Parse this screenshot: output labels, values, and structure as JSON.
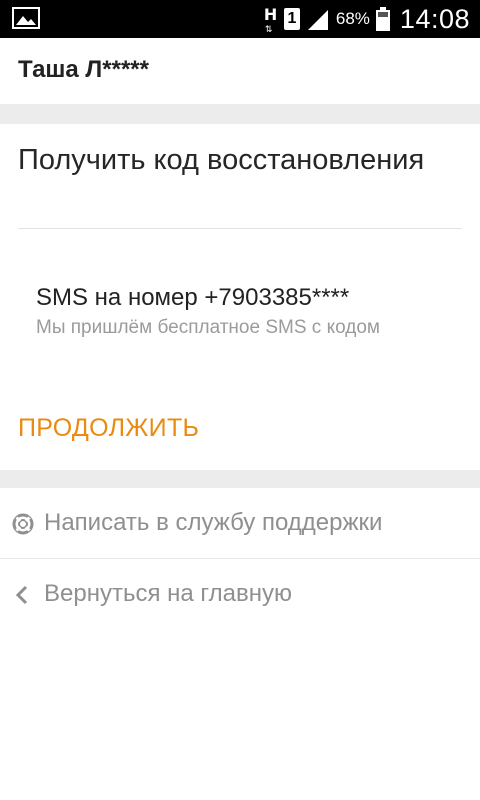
{
  "status_bar": {
    "network_type": "H",
    "network_arrows": "⇅",
    "sim_slot": "1",
    "battery_percent": "68%",
    "time": "14:08",
    "icons": [
      "image-icon",
      "signal-icon",
      "battery-icon"
    ]
  },
  "header": {
    "user_name": "Таша Л*****"
  },
  "card": {
    "title": "Получить код восстановления",
    "option_title": "SMS на номер +7903385****",
    "option_description": "Мы пришлём бесплатное SMS с кодом",
    "continue_label": "ПРОДОЛЖИТЬ"
  },
  "links": {
    "support_label": "Написать в службу поддержки",
    "support_icon": "lifebuoy-icon",
    "back_label": "Вернуться на главную",
    "back_icon": "chevron-left-icon"
  },
  "colors": {
    "accent": "#eb8a10",
    "separator": "#ececec",
    "muted_text": "#8f8f8f"
  }
}
